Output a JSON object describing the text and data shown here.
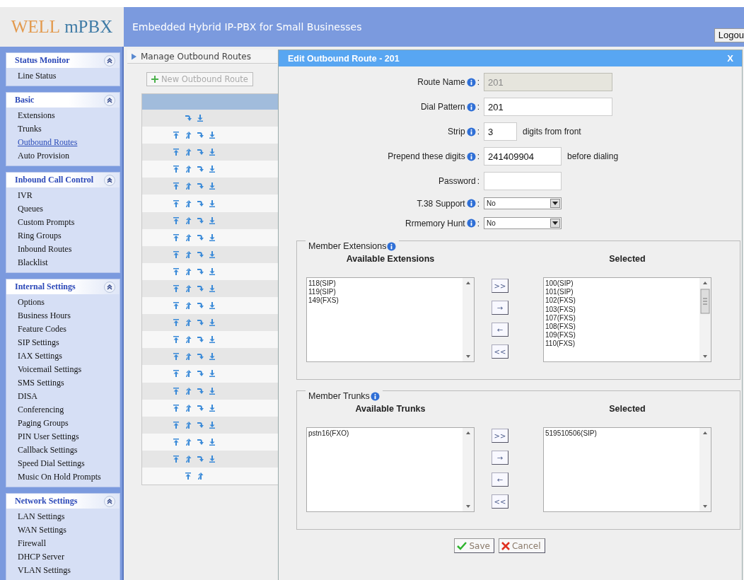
{
  "header": {
    "logo_primary": "WELL",
    "logo_secondary": "mPBX",
    "tagline": "Embedded Hybrid IP-PBX for Small Businesses",
    "logout": "Logou"
  },
  "sidebar": {
    "sections": [
      {
        "title": "Status Monitor",
        "expanded": true,
        "items": [
          {
            "label": "Line Status",
            "selected": false
          }
        ]
      },
      {
        "title": "Basic",
        "expanded": true,
        "items": [
          {
            "label": "Extensions",
            "selected": false
          },
          {
            "label": "Trunks",
            "selected": false
          },
          {
            "label": "Outbound Routes",
            "selected": true
          },
          {
            "label": "Auto Provision",
            "selected": false
          }
        ]
      },
      {
        "title": "Inbound Call Control",
        "expanded": true,
        "items": [
          {
            "label": "IVR",
            "selected": false
          },
          {
            "label": "Queues",
            "selected": false
          },
          {
            "label": "Custom Prompts",
            "selected": false
          },
          {
            "label": "Ring Groups",
            "selected": false
          },
          {
            "label": "Inbound Routes",
            "selected": false
          },
          {
            "label": "Blacklist",
            "selected": false
          }
        ]
      },
      {
        "title": "Internal Settings",
        "expanded": true,
        "items": [
          {
            "label": "Options",
            "selected": false
          },
          {
            "label": "Business Hours",
            "selected": false
          },
          {
            "label": "Feature Codes",
            "selected": false
          },
          {
            "label": "SIP Settings",
            "selected": false
          },
          {
            "label": "IAX Settings",
            "selected": false
          },
          {
            "label": "Voicemail Settings",
            "selected": false
          },
          {
            "label": "SMS Settings",
            "selected": false
          },
          {
            "label": "DISA",
            "selected": false
          },
          {
            "label": "Conferencing",
            "selected": false
          },
          {
            "label": "Paging Groups",
            "selected": false
          },
          {
            "label": "PIN User Settings",
            "selected": false
          },
          {
            "label": "Callback Settings",
            "selected": false
          },
          {
            "label": "Speed Dial Settings",
            "selected": false
          },
          {
            "label": "Music On Hold Prompts",
            "selected": false
          }
        ]
      },
      {
        "title": "Network Settings",
        "expanded": true,
        "items": [
          {
            "label": "LAN Settings",
            "selected": false
          },
          {
            "label": "WAN Settings",
            "selected": false
          },
          {
            "label": "Firewall",
            "selected": false
          },
          {
            "label": "DHCP Server",
            "selected": false
          },
          {
            "label": "VLAN Settings",
            "selected": false
          }
        ]
      }
    ]
  },
  "page_tab": {
    "title": "Manage Outbound Routes"
  },
  "new_button": {
    "label": "New Outbound Route",
    "disabled": true
  },
  "routes_table": {
    "rows": [
      {
        "move_top": false,
        "move_up": false,
        "move_down": true,
        "move_bottom": true
      },
      {
        "move_top": true,
        "move_up": true,
        "move_down": true,
        "move_bottom": true
      },
      {
        "move_top": true,
        "move_up": true,
        "move_down": true,
        "move_bottom": true
      },
      {
        "move_top": true,
        "move_up": true,
        "move_down": true,
        "move_bottom": true
      },
      {
        "move_top": true,
        "move_up": true,
        "move_down": true,
        "move_bottom": true
      },
      {
        "move_top": true,
        "move_up": true,
        "move_down": true,
        "move_bottom": true
      },
      {
        "move_top": true,
        "move_up": true,
        "move_down": true,
        "move_bottom": true
      },
      {
        "move_top": true,
        "move_up": true,
        "move_down": true,
        "move_bottom": true
      },
      {
        "move_top": true,
        "move_up": true,
        "move_down": true,
        "move_bottom": true
      },
      {
        "move_top": true,
        "move_up": true,
        "move_down": true,
        "move_bottom": true
      },
      {
        "move_top": true,
        "move_up": true,
        "move_down": true,
        "move_bottom": true
      },
      {
        "move_top": true,
        "move_up": true,
        "move_down": true,
        "move_bottom": true
      },
      {
        "move_top": true,
        "move_up": true,
        "move_down": true,
        "move_bottom": true
      },
      {
        "move_top": true,
        "move_up": true,
        "move_down": true,
        "move_bottom": true
      },
      {
        "move_top": true,
        "move_up": true,
        "move_down": true,
        "move_bottom": true
      },
      {
        "move_top": true,
        "move_up": true,
        "move_down": true,
        "move_bottom": true
      },
      {
        "move_top": true,
        "move_up": true,
        "move_down": true,
        "move_bottom": true
      },
      {
        "move_top": true,
        "move_up": true,
        "move_down": true,
        "move_bottom": true
      },
      {
        "move_top": true,
        "move_up": true,
        "move_down": true,
        "move_bottom": true
      },
      {
        "move_top": true,
        "move_up": true,
        "move_down": true,
        "move_bottom": true
      },
      {
        "move_top": true,
        "move_up": true,
        "move_down": true,
        "move_bottom": true
      },
      {
        "move_top": true,
        "move_up": true,
        "move_down": false,
        "move_bottom": false
      }
    ]
  },
  "dialog": {
    "title": "Edit Outbound Route - 201",
    "close": "X",
    "fields": [
      {
        "kind": "text",
        "label": "Route Name",
        "info": true,
        "separator": ":",
        "value": "201",
        "disabled": true
      },
      {
        "kind": "text",
        "label": "Dial Pattern",
        "info": true,
        "separator": ":",
        "value": "201",
        "disabled": false
      },
      {
        "kind": "text",
        "label": "Strip",
        "info": true,
        "separator": ":",
        "value": "3",
        "disabled": false,
        "suffix": "digits from front"
      },
      {
        "kind": "text",
        "label": "Prepend these digits",
        "info": true,
        "separator": ":",
        "value": "241409904",
        "disabled": false,
        "suffix": "before dialing"
      },
      {
        "kind": "password",
        "label": "Password",
        "info": false,
        "separator": ":"
      },
      {
        "kind": "select",
        "label": "T.38 Support",
        "info": true,
        "separator": ":",
        "value": "No"
      },
      {
        "kind": "select",
        "label": "Rrmemory Hunt",
        "info": true,
        "separator": ":",
        "value": "No"
      }
    ],
    "groups": [
      {
        "legend": "Member Extensions",
        "available_heading": "Available Extensions",
        "selected_heading": "Selected",
        "available": [
          "118(SIP)",
          "119(SIP)",
          "149(FXS)"
        ],
        "selected": [
          "100(SIP)",
          "101(SIP)",
          "102(FXS)",
          "103(FXS)",
          "107(FXS)",
          "108(FXS)",
          "109(FXS)",
          "110(FXS)"
        ],
        "buttons": [
          ">>",
          "→",
          "←",
          "<<"
        ]
      },
      {
        "legend": "Member Trunks",
        "available_heading": "Available Trunks",
        "selected_heading": "Selected",
        "available": [
          "pstn16(FXO)"
        ],
        "selected": [
          "519510506(SIP)"
        ],
        "buttons": [
          ">>",
          "→",
          "←",
          "<<"
        ]
      }
    ],
    "save": "Save",
    "cancel": "Cancel"
  }
}
